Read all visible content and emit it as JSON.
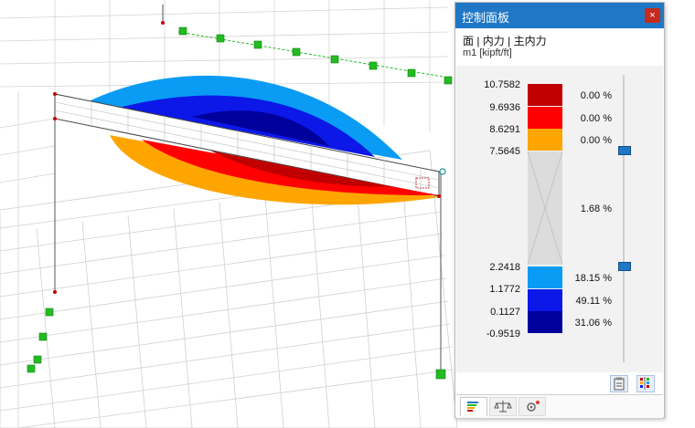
{
  "panel": {
    "title": "控制面板",
    "breadcrumb": "面 | 内力 | 主内力",
    "unit_label": "m1 [kipft/ft]",
    "close_label": "×"
  },
  "legend": {
    "tick_values": [
      "10.7582",
      "9.6936",
      "8.6291",
      "7.5645",
      "2.2418",
      "1.1772",
      "0.1127",
      "-0.9519"
    ],
    "bands": [
      {
        "color": "#c00000",
        "percent": "0.00 %"
      },
      {
        "color": "#ff0000",
        "percent": "0.00 %"
      },
      {
        "color": "#ffa500",
        "percent": "0.00 %"
      },
      {
        "color": "#dcdcdc",
        "percent": "1.68 %"
      },
      {
        "color": "#0a9cf5",
        "percent": "18.15 %"
      },
      {
        "color": "#0c18e8",
        "percent": "49.11 %"
      },
      {
        "color": "#00009c",
        "percent": "31.06 %"
      }
    ]
  },
  "colors": {
    "accent": "#1f77c5",
    "arrow": "#e03a3a",
    "support": "#22bb22"
  },
  "icons": {
    "tool_1": "clipboard-icon",
    "tool_2": "color-scale-icon",
    "tab_1": "legend-colors-icon",
    "tab_2": "balance-icon",
    "tab_3": "settings-icon"
  }
}
